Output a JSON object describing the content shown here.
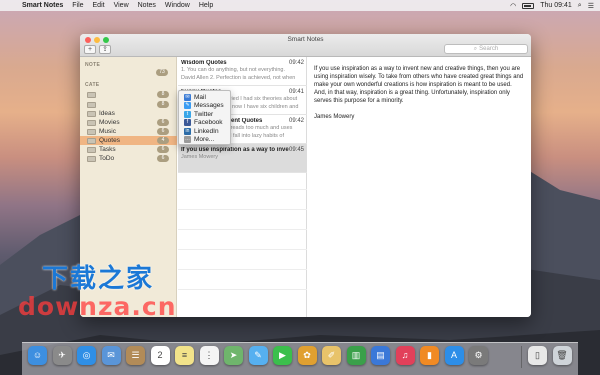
{
  "menubar": {
    "apple": "",
    "app_name": "Smart Notes",
    "menus": [
      "File",
      "Edit",
      "View",
      "Notes",
      "Window",
      "Help"
    ],
    "clock": "Thu 09:41"
  },
  "window": {
    "title": "Smart Notes",
    "add_label": "+",
    "search_placeholder": "Search"
  },
  "share_menu": [
    {
      "label": "Mail",
      "color": "#3a7bd5",
      "icon": "mail-icon"
    },
    {
      "label": "Messages",
      "color": "#3b9cf2",
      "icon": "messages-icon"
    },
    {
      "label": "Twitter",
      "color": "#39a6e8",
      "icon": "twitter-icon"
    },
    {
      "label": "Facebook",
      "color": "#3b5998",
      "icon": "facebook-icon"
    },
    {
      "label": "LinkedIn",
      "color": "#2c6ca8",
      "icon": "linkedin-icon"
    },
    {
      "label": "More...",
      "color": "#9a9a9a",
      "icon": "more-icon"
    }
  ],
  "sidebar": {
    "notes_label": "NOTE",
    "notes_count": "73",
    "categories_label": "CATE",
    "folders": [
      {
        "label": "",
        "count": "8"
      },
      {
        "label": "",
        "count": "8"
      },
      {
        "label": "Ideas",
        "count": ""
      },
      {
        "label": "Movies",
        "count": "6"
      },
      {
        "label": "Music",
        "count": "6"
      },
      {
        "label": "Quotes",
        "count": "4"
      },
      {
        "label": "Tasks",
        "count": "6"
      },
      {
        "label": "ToDo",
        "count": "6"
      }
    ]
  },
  "notes": [
    {
      "title": "Wisdom Quotes",
      "time": "09:42",
      "l1": "1. You can do anything, but not everything.",
      "l2": "David Allen 2. Perfection is achieved, not when"
    },
    {
      "title": "Funny Quotes",
      "time": "09:41",
      "l1": "21. Before I got married I had six theories about",
      "l2": "bringing up children; now I have six children and"
    },
    {
      "title": "Otherwise Intelligent Quotes",
      "time": "09:42",
      "l1": "11. The person who reads too much and uses",
      "l2": "his brain too little will fall into lazy habits of"
    },
    {
      "title": "If you use inspiration as a way to invent new and creative",
      "time": "09:45",
      "l1": "James Mowery",
      "l2": ""
    }
  ],
  "content": {
    "body": "If you use inspiration as a way to invent new and creative things, then you are using inspiration wisely. To take from others who have created great things and make your own wonderful creations is how inspiration is meant to be used. And, in that way, inspiration is a great thing. Unfortunately, inspiration only serves this purpose for a minority.",
    "author": "James Mowery"
  },
  "watermark": {
    "line1": "下载之家",
    "line2": "downza.cn"
  },
  "dock": [
    {
      "icon": "finder-icon",
      "color": "#3d8fe0",
      "glyph": "☺"
    },
    {
      "icon": "launchpad-icon",
      "color": "#8a8a8a",
      "glyph": "✈"
    },
    {
      "icon": "safari-icon",
      "color": "#2f8fe6",
      "glyph": "◎"
    },
    {
      "icon": "mail-app-icon",
      "color": "#5a95d8",
      "glyph": "✉"
    },
    {
      "icon": "contacts-icon",
      "color": "#b28b58",
      "glyph": "☰"
    },
    {
      "icon": "calendar-icon",
      "color": "#ffffff",
      "glyph": "2"
    },
    {
      "icon": "notes-app-icon",
      "color": "#f2e38a",
      "glyph": "≡"
    },
    {
      "icon": "reminders-icon",
      "color": "#f4f4f4",
      "glyph": "⋮"
    },
    {
      "icon": "maps-icon",
      "color": "#6fb56c",
      "glyph": "➤"
    },
    {
      "icon": "messages-app-icon",
      "color": "#56b0f0",
      "glyph": "✎"
    },
    {
      "icon": "facetime-icon",
      "color": "#3bbf4c",
      "glyph": "▶"
    },
    {
      "icon": "photos-icon",
      "color": "#e0a030",
      "glyph": "✿"
    },
    {
      "icon": "smart-notes-icon",
      "color": "#e8c36a",
      "glyph": "✐"
    },
    {
      "icon": "numbers-icon",
      "color": "#3aa04a",
      "glyph": "▥"
    },
    {
      "icon": "keynote-icon",
      "color": "#3a78d8",
      "glyph": "▤"
    },
    {
      "icon": "itunes-icon",
      "color": "#e2405a",
      "glyph": "♫"
    },
    {
      "icon": "ibooks-icon",
      "color": "#f08a24",
      "glyph": "▮"
    },
    {
      "icon": "app-store-icon",
      "color": "#2d8ee8",
      "glyph": "A"
    },
    {
      "icon": "system-preferences-icon",
      "color": "#7a7a7a",
      "glyph": "⚙"
    },
    {
      "icon": "document-icon",
      "color": "#e8e8e8",
      "glyph": "▯"
    },
    {
      "icon": "trash-icon",
      "color": "#cfd4d9",
      "glyph": "🗑"
    }
  ]
}
